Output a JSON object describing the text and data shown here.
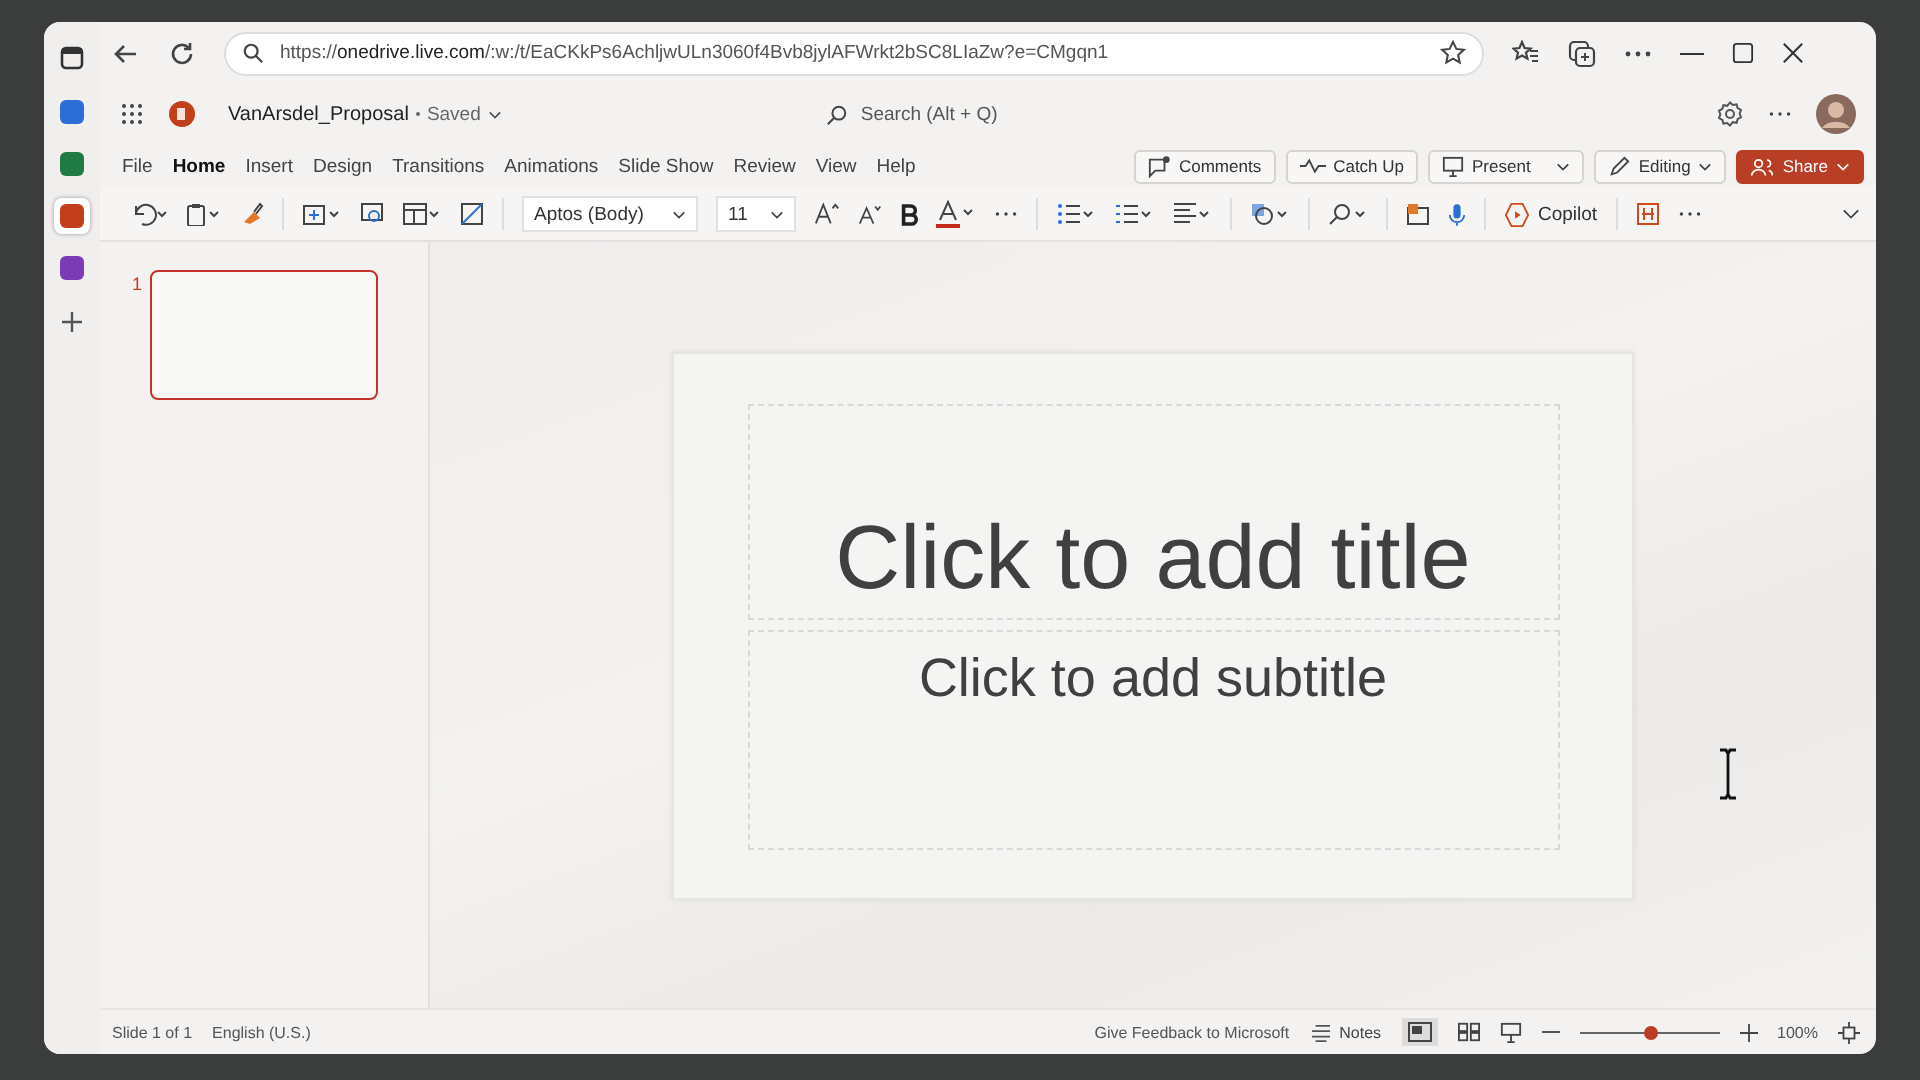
{
  "browser": {
    "url_prefix": "https://",
    "url_host": "onedrive.live.com",
    "url_rest": "/:w:/t/EaCKkPs6AchljwULn3060f4Bvb8jylAFWrkt2bSC8LIaZw?e=CMgqn1"
  },
  "rail": [
    {
      "kind": "word",
      "selected": false
    },
    {
      "kind": "excel",
      "selected": false
    },
    {
      "kind": "powerpoint",
      "selected": true
    },
    {
      "kind": "onenote",
      "selected": false
    }
  ],
  "header": {
    "file_name": "VanArsdel_Proposal",
    "status": "Saved",
    "search_placeholder": "Search (Alt + Q)"
  },
  "tabs": [
    {
      "label": "File",
      "selected": false
    },
    {
      "label": "Home",
      "selected": true
    },
    {
      "label": "Insert",
      "selected": false
    },
    {
      "label": "Design",
      "selected": false
    },
    {
      "label": "Transitions",
      "selected": false
    },
    {
      "label": "Animations",
      "selected": false
    },
    {
      "label": "Slide Show",
      "selected": false
    },
    {
      "label": "Review",
      "selected": false
    },
    {
      "label": "View",
      "selected": false
    },
    {
      "label": "Help",
      "selected": false
    }
  ],
  "actions": {
    "comments": "Comments",
    "catch_up": "Catch Up",
    "present": "Present",
    "editing": "Editing",
    "share": "Share"
  },
  "ribbon": {
    "font": "Aptos (Body)",
    "size": "11",
    "copilot": "Copilot"
  },
  "slides": [
    {
      "number": "1",
      "selected": true
    }
  ],
  "slide": {
    "title_placeholder": "Click to add title",
    "subtitle_placeholder": "Click to add subtitle"
  },
  "status_bar": {
    "slide": "Slide 1 of 1",
    "language": "English (U.S.)",
    "feedback": "Give Feedback to Microsoft",
    "notes": "Notes",
    "zoom": "100%",
    "zoom_slider": {
      "level": 0.5
    }
  }
}
